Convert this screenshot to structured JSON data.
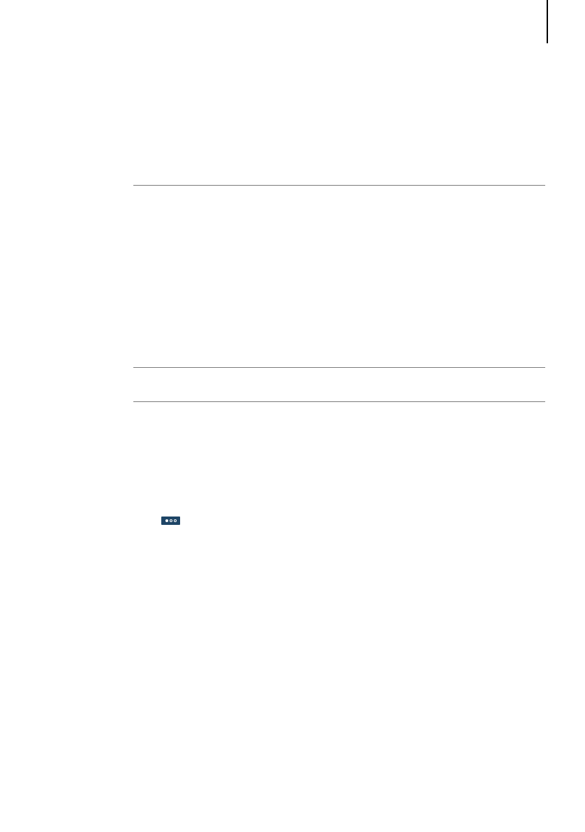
{
  "colors": {
    "page_background": "#ffffff",
    "margin_bar": "#000000",
    "rule_line": "#7a7a7a",
    "badge_background": "#1e4566",
    "badge_dot": "#ffffff"
  },
  "indicator": {
    "icon": "page-dots-indicator-icon",
    "dots_total": 3,
    "active_dot": 1
  }
}
